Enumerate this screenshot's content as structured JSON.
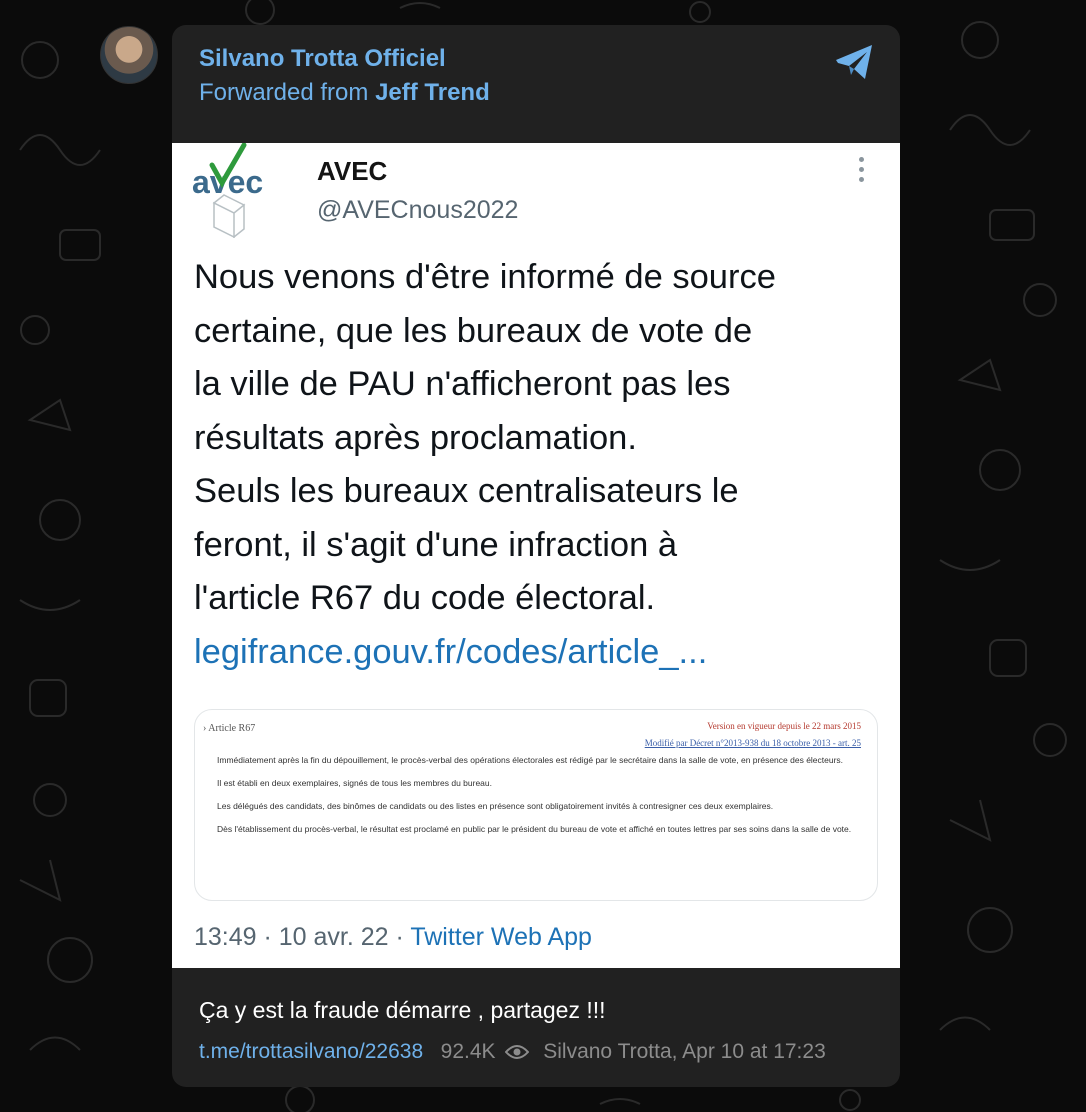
{
  "post": {
    "channel_name": "Silvano Trotta Officiel",
    "forwarded_prefix": "Forwarded from",
    "forwarded_from": "Jeff Trend",
    "caption": "Ça y est la fraude démarre , partagez !!!",
    "post_link": "t.me/trottasilvano/22638",
    "views": "92.4K",
    "signature": "Silvano Trotta, Apr 10 at 17:23"
  },
  "tweet": {
    "logo_text": "avec",
    "account_name": "AVEC",
    "handle": "@AVECnous2022",
    "lines": [
      "Nous venons d'être informé de source",
      "certaine, que les bureaux de vote de",
      "la ville de PAU n'afficheront pas les",
      "résultats après proclamation.",
      "Seuls les bureaux centralisateurs le",
      "feront, il s'agit d'une infraction à",
      "l'article R67 du code électoral."
    ],
    "link": "legifrance.gouv.fr/codes/article_...",
    "time": "13:49 · 10 avr. 22 ·",
    "source": "Twitter Web App"
  },
  "card": {
    "title": "› Article R67",
    "version": "Version en vigueur depuis le 22 mars 2015",
    "modified": "Modifié par Décret n°2013-938 du 18 octobre 2013 - art. 25",
    "paragraphs": [
      "Immédiatement après la fin du dépouillement, le procès-verbal des opérations électorales est rédigé par le secrétaire dans la salle de vote, en présence des électeurs.",
      "Il est établi en deux exemplaires, signés de tous les membres du bureau.",
      "Les délégués des candidats, des binômes de candidats ou des listes en présence sont obligatoirement invités à contresigner ces deux exemplaires.",
      "Dès l'établissement du procès-verbal, le résultat est proclamé en public par le président du bureau de vote et affiché en toutes lettres par ses soins dans la salle de vote."
    ]
  },
  "colors": {
    "accent": "#6fb1ea",
    "bubble": "#212121",
    "background": "#0b0b0b",
    "tweet_link": "#1d72b6",
    "logo_green": "#2e9a3c"
  },
  "icons": [
    "telegram-share-icon",
    "more-dots-icon",
    "eye-icon",
    "ballot-box-icon"
  ]
}
